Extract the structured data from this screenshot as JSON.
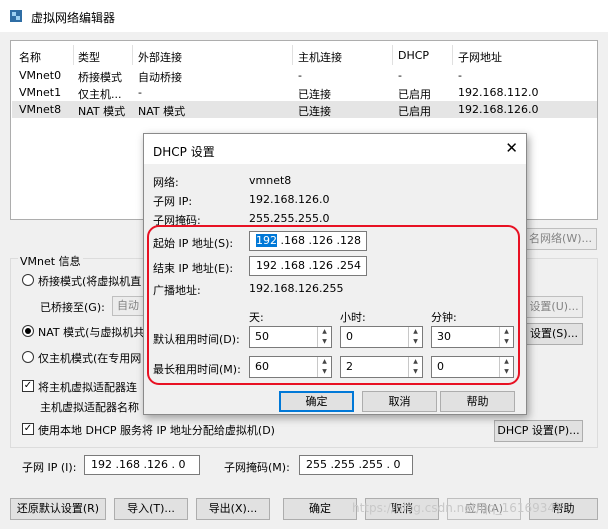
{
  "window": {
    "title": "虚拟网络编辑器",
    "icon": "virtual-network-editor-icon"
  },
  "table": {
    "headers": [
      "名称",
      "类型",
      "外部连接",
      "主机连接",
      "DHCP",
      "子网地址"
    ],
    "rows": [
      {
        "name": "VMnet0",
        "type": "桥接模式",
        "external": "自动桥接",
        "host": "-",
        "dhcp": "-",
        "subnet": "-",
        "selected": false
      },
      {
        "name": "VMnet1",
        "type": "仅主机...",
        "external": "-",
        "host": "已连接",
        "dhcp": "已启用",
        "subnet": "192.168.112.0",
        "selected": false
      },
      {
        "name": "VMnet8",
        "type": "NAT 模式",
        "external": "NAT 模式",
        "host": "已连接",
        "dhcp": "已启用",
        "subnet": "192.168.126.0",
        "selected": true
      }
    ]
  },
  "side_button_partial": "名网络(W)...",
  "vmnet_info": {
    "group_label": "VMnet 信息",
    "bridge_radio": "桥接模式(将虚拟机直",
    "bridged_to_label": "已桥接至(G):",
    "bridged_to_value": "自动",
    "auto_settings_partial": "设置(U)...",
    "nat_radio": "NAT 模式(与虚拟机共",
    "nat_settings_partial": "设置(S)...",
    "host_only_radio": "仅主机模式(在专用网",
    "connect_adapter_check": "将主机虚拟适配器连",
    "adapter_name_label": "主机虚拟适配器名称",
    "dhcp_check": "使用本地 DHCP 服务将 IP 地址分配给虚拟机(D)",
    "dhcp_settings_button": "DHCP 设置(P)...",
    "subnet_ip_label": "子网 IP (I):",
    "subnet_ip_value": "192 .168 .126 . 0",
    "subnet_mask_label": "子网掩码(M):",
    "subnet_mask_value": "255 .255 .255 . 0"
  },
  "bottom_buttons": {
    "restore": "还原默认设置(R)",
    "import": "导入(T)...",
    "export": "导出(X)...",
    "ok": "确定",
    "cancel": "取消",
    "apply": "应用(A)",
    "help": "帮助"
  },
  "watermark": "https://blog.csdn.net/qq_16169347",
  "dhcp_dialog": {
    "title": "DHCP 设置",
    "close": "✕",
    "network_label": "网络:",
    "network_value": "vmnet8",
    "subnet_ip_label": "子网 IP:",
    "subnet_ip_value": "192.168.126.0",
    "subnet_mask_label": "子网掩码:",
    "subnet_mask_value": "255.255.255.0",
    "start_ip_label": "起始 IP 地址(S):",
    "start_ip_first": "192",
    "start_ip_rest": " .168 .126 .128",
    "end_ip_label": "结束 IP 地址(E):",
    "end_ip_value": "192 .168 .126 .254",
    "broadcast_label": "广播地址:",
    "broadcast_value": "192.168.126.255",
    "days_label": "天:",
    "hours_label": "小时:",
    "minutes_label": "分钟:",
    "default_lease_label": "默认租用时间(D):",
    "default_lease": {
      "days": "50",
      "hours": "0",
      "minutes": "30"
    },
    "max_lease_label": "最长租用时间(M):",
    "max_lease": {
      "days": "60",
      "hours": "2",
      "minutes": "0"
    },
    "ok": "确定",
    "cancel": "取消",
    "help": "帮助"
  },
  "colors": {
    "highlight": "#e81123",
    "selection": "#0078d7"
  }
}
